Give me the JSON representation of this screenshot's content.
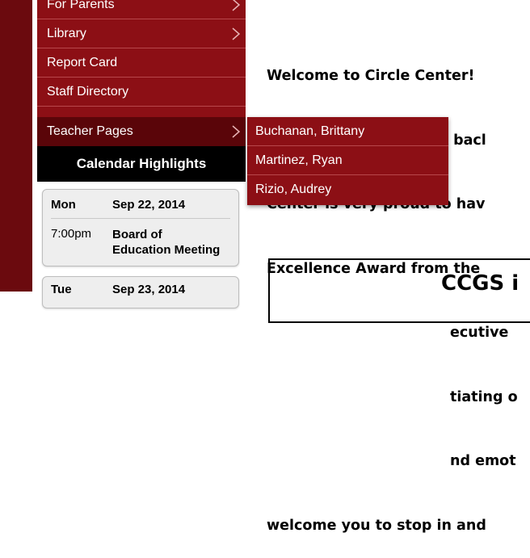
{
  "nav": {
    "items": [
      {
        "label": "For Parents",
        "has_submenu": true
      },
      {
        "label": "Library",
        "has_submenu": true
      },
      {
        "label": "Report Card",
        "has_submenu": false
      },
      {
        "label": "Staff Directory",
        "has_submenu": false
      },
      {
        "label": "Teacher Pages",
        "has_submenu": true,
        "selected": true
      }
    ]
  },
  "submenu": {
    "items": [
      {
        "label": "Buchanan, Brittany"
      },
      {
        "label": "Martinez, Ryan"
      },
      {
        "label": "Rizio, Audrey"
      }
    ]
  },
  "calendar": {
    "header": "Calendar Highlights",
    "events": [
      {
        "day": "Mon",
        "date": "Sep 22, 2014",
        "time": "7:00pm",
        "title_line1": "Board of",
        "title_line2": "Education Meeting"
      },
      {
        "day": "Tue",
        "date": "Sep 23, 2014"
      }
    ]
  },
  "welcome": {
    "lines": [
      "Welcome to Circle Center!",
      "page and please check bacl",
      "Center is very proud to hav",
      "Excellence Award from the",
      "ecutive ",
      "tiating o",
      "nd emot",
      "welcome you to stop in and"
    ]
  },
  "banner": {
    "title": "CCGS i"
  },
  "colors": {
    "nav_bg": "#8c0f15",
    "nav_selected": "#5a0509",
    "left_strip": "#6b0a0e",
    "calendar_header_bg": "#000000"
  }
}
